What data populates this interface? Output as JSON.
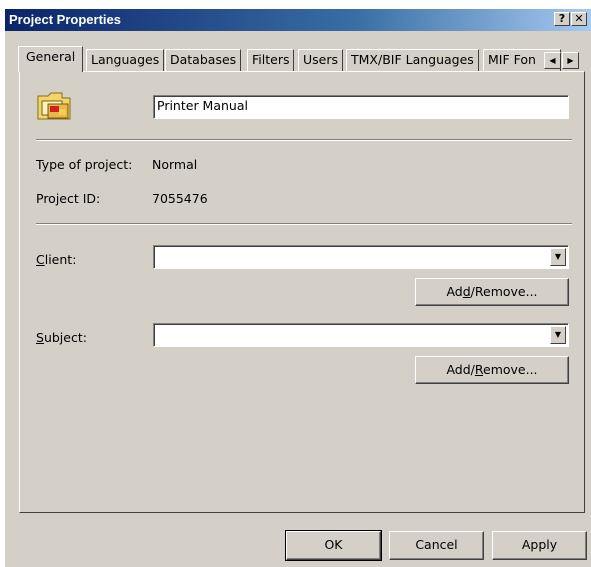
{
  "window": {
    "title": "Project Properties",
    "help_label": "?",
    "close_label": "✕"
  },
  "tabs": [
    {
      "label": "General"
    },
    {
      "label": "Languages"
    },
    {
      "label": "Databases"
    },
    {
      "label": "Filters"
    },
    {
      "label": "Users"
    },
    {
      "label": "TMX/BIF Languages"
    },
    {
      "label": "MIF Fon"
    }
  ],
  "tab_scroll": {
    "left": "◀",
    "right": "▶"
  },
  "general": {
    "project_name": "Printer Manual",
    "type_label": "Type of project:",
    "type_value": "Normal",
    "id_label": "Project ID:",
    "id_value": "7055476",
    "client": {
      "label_pre": "",
      "label_key": "C",
      "label_post": "lient:",
      "value": ""
    },
    "client_button": {
      "pre": "Ad",
      "key": "d",
      "post": "/Remove..."
    },
    "subject": {
      "label_pre": "",
      "label_key": "S",
      "label_post": "ubject:",
      "value": ""
    },
    "subject_button": {
      "pre": "Add/",
      "key": "R",
      "post": "emove..."
    },
    "dropdown_arrow": "▼"
  },
  "footer": {
    "ok": "OK",
    "cancel": "Cancel",
    "apply": "Apply"
  },
  "colors": {
    "title_start": "#0a246a",
    "title_end": "#a6caf0",
    "face": "#d4d0c8"
  },
  "icons": {
    "project": "project-folder-icon"
  }
}
